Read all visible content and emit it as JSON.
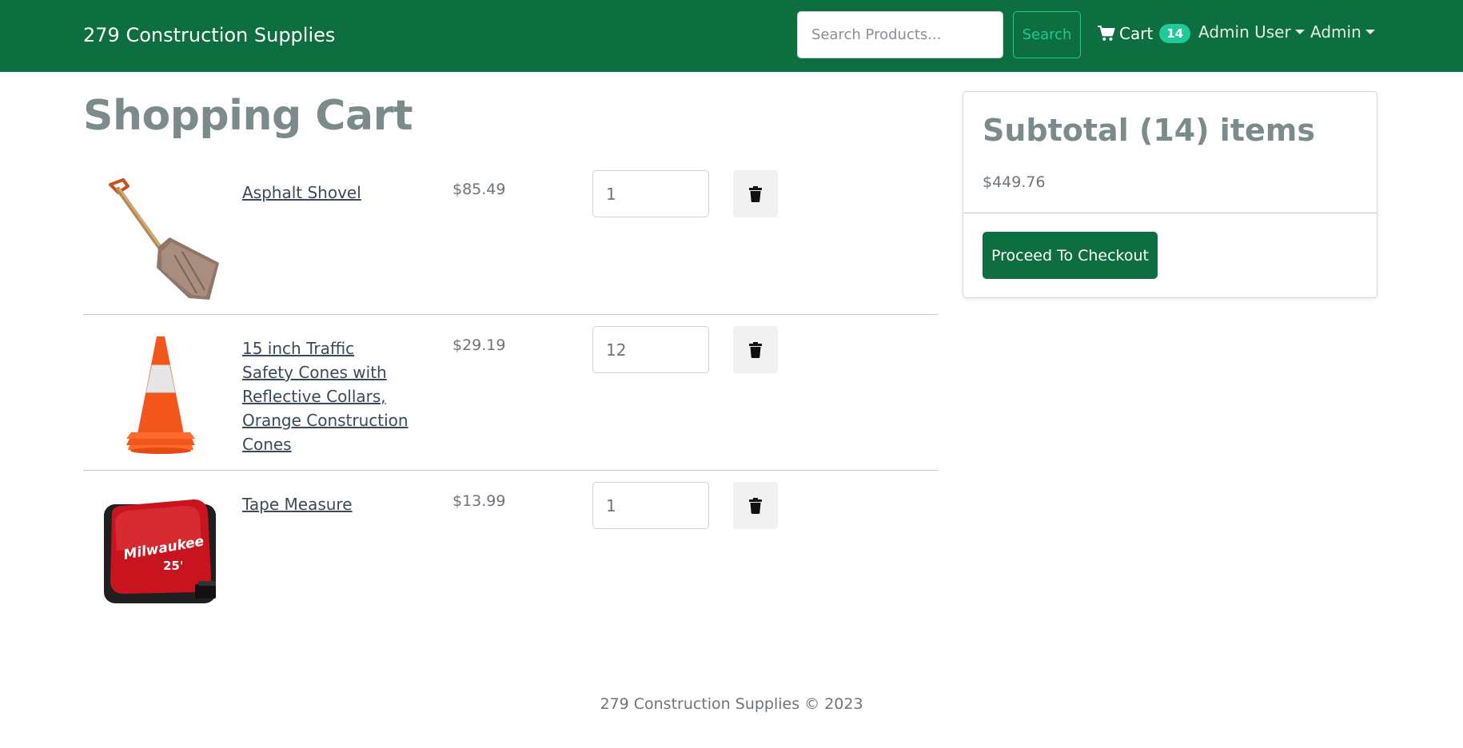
{
  "navbar": {
    "brand": "279 Construction Supplies",
    "search_placeholder": "Search Products...",
    "search_button": "Search",
    "cart_label": "Cart",
    "cart_count": "14",
    "user_menu": "Admin User",
    "admin_menu": "Admin",
    "colors": {
      "navbar_bg": "#0d6e3f",
      "accent": "#20c997"
    }
  },
  "page_title": "Shopping Cart",
  "cart_items": [
    {
      "name": "Asphalt Shovel",
      "price": "$85.49",
      "quantity": "1",
      "image_icon": "shovel-image"
    },
    {
      "name": "15 inch Traffic Safety Cones with Reflective Collars, Orange Construction Cones",
      "price": "$29.19",
      "quantity": "12",
      "image_icon": "traffic-cone-image"
    },
    {
      "name": "Tape Measure",
      "price": "$13.99",
      "quantity": "1",
      "image_icon": "tape-measure-image"
    }
  ],
  "summary": {
    "title": "Subtotal (14) items",
    "total": "$449.76",
    "checkout_button": "Proceed To Checkout"
  },
  "footer": "279 Construction Supplies © 2023"
}
